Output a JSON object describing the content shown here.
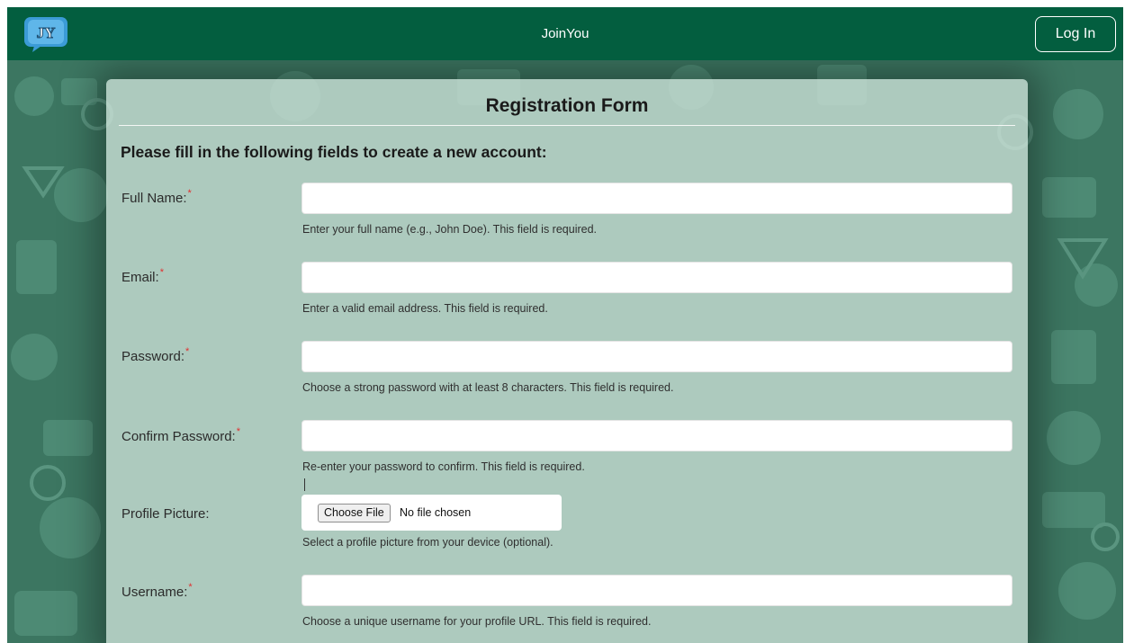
{
  "header": {
    "logo_text": "JY",
    "app_title": "JoinYou",
    "login_label": "Log In"
  },
  "form": {
    "title": "Registration Form",
    "subtitle": "Please fill in the following fields to create a new account:",
    "required_marker": "*",
    "fields": [
      {
        "label": "Full Name:",
        "required": true,
        "value": "",
        "help": "Enter your full name (e.g., John Doe). This field is required."
      },
      {
        "label": "Email:",
        "required": true,
        "value": "",
        "help": "Enter a valid email address. This field is required."
      },
      {
        "label": "Password:",
        "required": true,
        "value": "",
        "help": "Choose a strong password with at least 8 characters. This field is required."
      },
      {
        "label": "Confirm Password:",
        "required": true,
        "value": "",
        "help": "Re-enter your password to confirm. This field is required."
      },
      {
        "label": "Username:",
        "required": true,
        "value": "",
        "help": "Choose a unique username for your profile URL. This field is required."
      }
    ],
    "profile_picture": {
      "label": "Profile Picture:",
      "button_label": "Choose File",
      "status": "No file chosen",
      "help": "Select a profile picture from your device (optional)."
    }
  },
  "colors": {
    "header_bg": "#035e3f",
    "page_bg": "#3c7661",
    "card_bg": "#cde2d9",
    "required": "#e03030"
  }
}
